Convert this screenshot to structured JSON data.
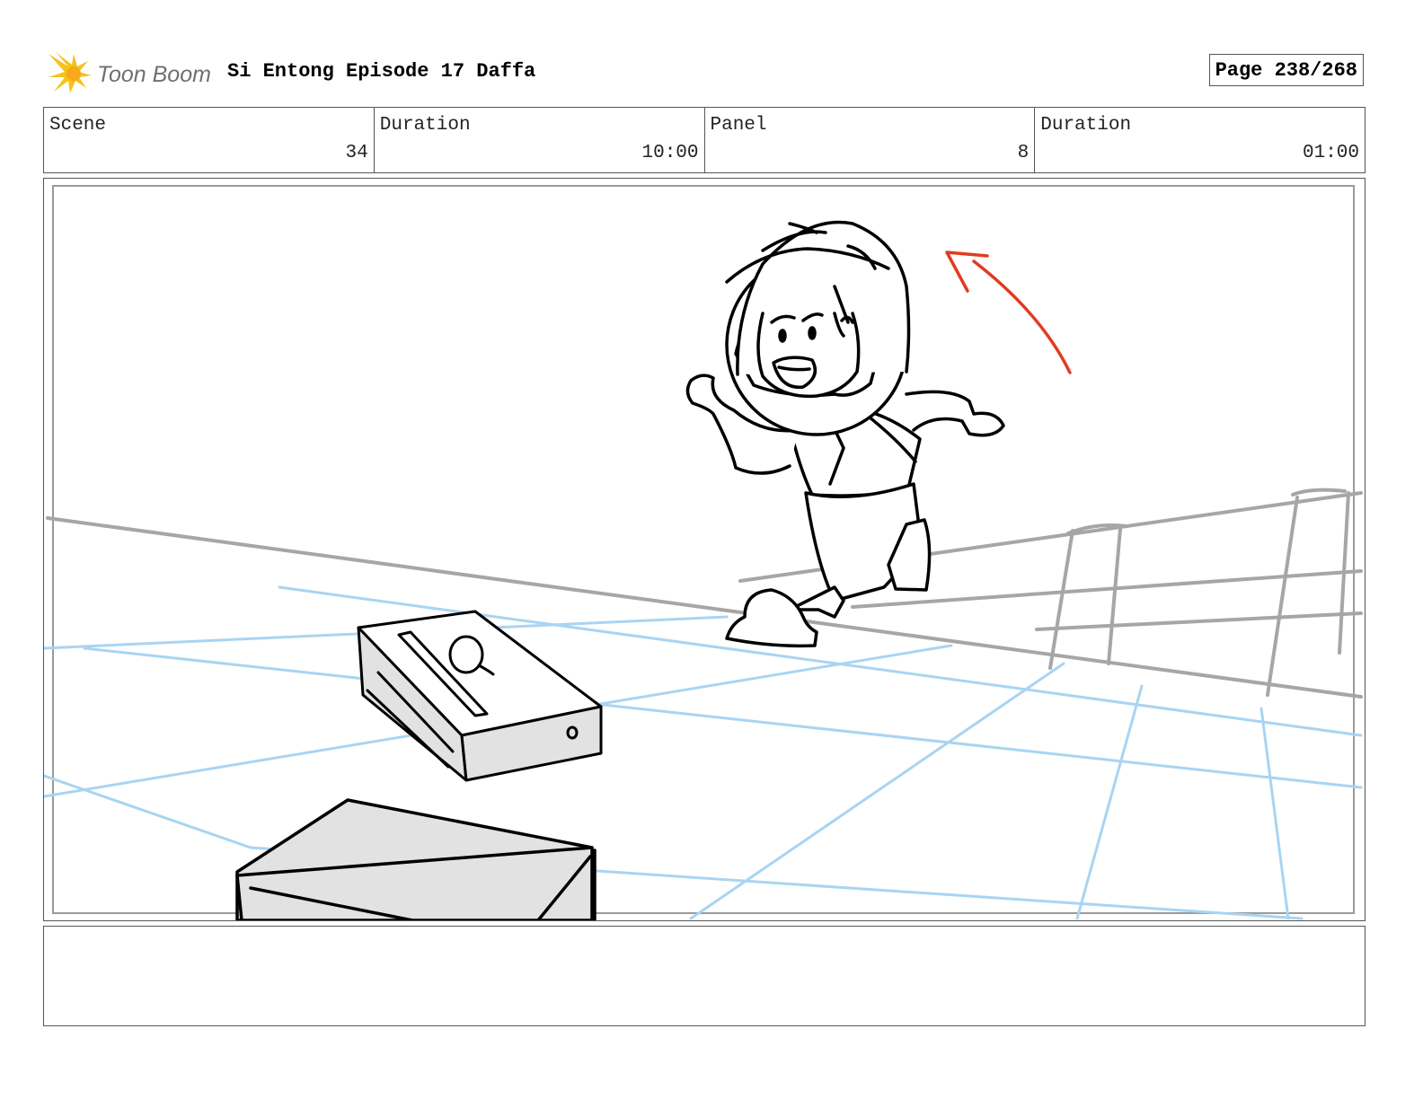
{
  "header": {
    "logo_text": "Toon Boom",
    "title": "Si Entong Episode 17 Daffa",
    "page": "Page 238/268"
  },
  "info": {
    "scene_label": "Scene",
    "scene_value": "34",
    "duration_label": "Duration",
    "duration_value": "10:00",
    "panel_label": "Panel",
    "panel_value": "8",
    "panel_duration_label": "Duration",
    "panel_duration_value": "01:00"
  },
  "panel_image": {
    "icons": [
      "toon-boom-logo-icon",
      "direction-arrow-icon"
    ],
    "colors": {
      "sketch": "#000000",
      "guides": "#a9d4f2",
      "rail": "#a6a6a6",
      "arrow": "#e23b20",
      "box_fill": "#e2e2e2"
    }
  },
  "notes": {
    "text": ""
  }
}
